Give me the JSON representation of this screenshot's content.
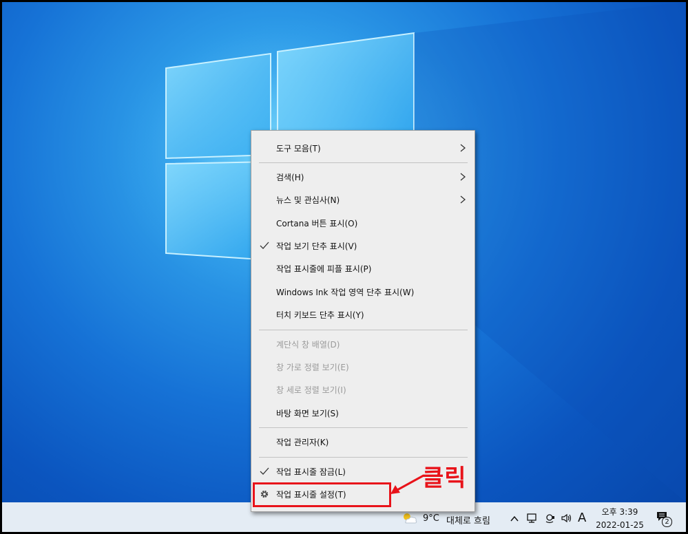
{
  "menu": {
    "items": [
      {
        "label": "도구 모음(T)",
        "submenu": true
      },
      {
        "label": "검색(H)",
        "submenu": true
      },
      {
        "label": "뉴스 및 관심사(N)",
        "submenu": true
      },
      {
        "label": "Cortana 버튼 표시(O)"
      },
      {
        "label": "작업 보기 단추 표시(V)",
        "checked": true
      },
      {
        "label": "작업 표시줄에 피플 표시(P)"
      },
      {
        "label": "Windows Ink 작업 영역 단추 표시(W)"
      },
      {
        "label": "터치 키보드 단추 표시(Y)"
      },
      {
        "label": "계단식 창 배열(D)",
        "disabled": true
      },
      {
        "label": "창 가로 정렬 보기(E)",
        "disabled": true
      },
      {
        "label": "창 세로 정렬 보기(I)",
        "disabled": true
      },
      {
        "label": "바탕 화면 보기(S)"
      },
      {
        "label": "작업 관리자(K)"
      },
      {
        "label": "작업 표시줄 잠금(L)",
        "checked": true
      },
      {
        "label": "작업 표시줄 설정(T)",
        "icon": "gear-icon"
      }
    ]
  },
  "annotation": {
    "text": "클릭",
    "color": "#e8131a"
  },
  "taskbar": {
    "weather": {
      "temp": "9°C",
      "condition": "대체로 흐림",
      "icon": "partly-cloudy-icon"
    },
    "ime": "A",
    "clock": {
      "time": "오후 3:39",
      "date": "2022-01-25"
    },
    "notifications": {
      "count": "2"
    }
  },
  "colors": {
    "desktop": "#0b55bf",
    "menu_bg": "#eeeeee",
    "highlight": "#e8131a"
  }
}
